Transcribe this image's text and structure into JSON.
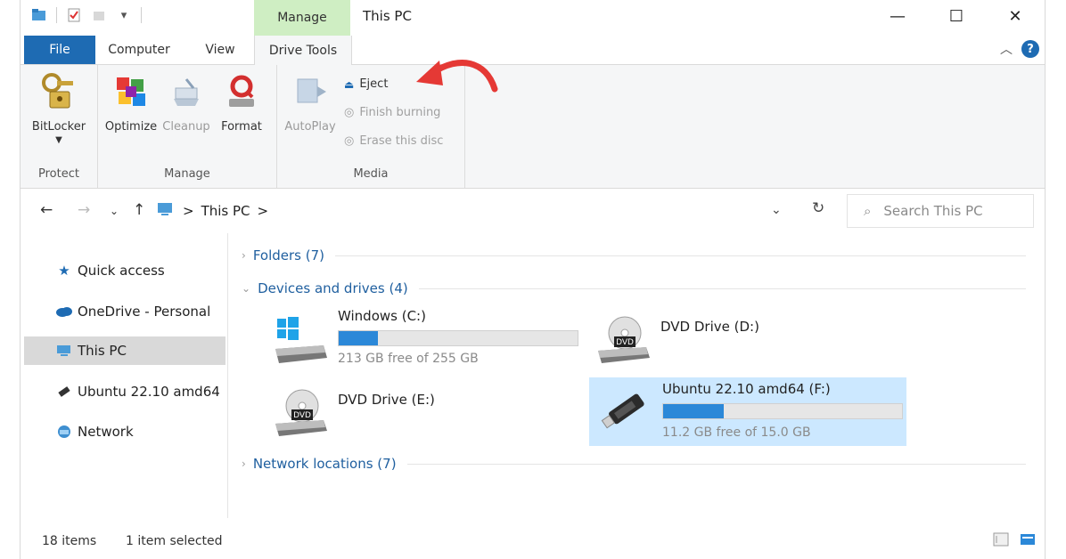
{
  "quick_access_toolbar": {
    "items": [
      "folder-icon",
      "properties-icon",
      "new-folder-icon",
      "dropdown-icon"
    ]
  },
  "context_tab_label": "Manage",
  "window_title": "This PC",
  "window_controls": {
    "minimize": "—",
    "maximize": "☐",
    "close": "✕"
  },
  "tabs": {
    "file": "File",
    "computer": "Computer",
    "view": "View",
    "drive_tools": "Drive Tools"
  },
  "ribbon": {
    "protect": {
      "label": "Protect",
      "bitlocker": "BitLocker"
    },
    "manage": {
      "label": "Manage",
      "optimize": "Optimize",
      "cleanup": "Cleanup",
      "format": "Format"
    },
    "media": {
      "label": "Media",
      "autoplay": "AutoPlay",
      "eject": "Eject",
      "finish_burning": "Finish burning",
      "erase_disc": "Erase this disc"
    }
  },
  "address_bar": {
    "path_label": "This PC",
    "separator": ">",
    "search_placeholder": "Search This PC"
  },
  "nav_pane": {
    "items": [
      {
        "label": "Quick access",
        "icon": "star-icon"
      },
      {
        "label": "OneDrive - Personal",
        "icon": "cloud-icon"
      },
      {
        "label": "This PC",
        "icon": "computer-icon",
        "selected": true
      },
      {
        "label": "Ubuntu 22.10 amd64",
        "icon": "usb-drive-icon"
      },
      {
        "label": "Network",
        "icon": "network-icon"
      }
    ]
  },
  "content": {
    "folders_header": "Folders (7)",
    "devices_header": "Devices and drives (4)",
    "network_header": "Network locations (7)",
    "drives": [
      {
        "name": "Windows (C:)",
        "free_text": "213 GB free of 255 GB",
        "used_fraction": 0.165,
        "icon": "windows-drive-icon"
      },
      {
        "name": "DVD Drive (D:)",
        "icon": "dvd-drive-icon"
      },
      {
        "name": "DVD Drive (E:)",
        "icon": "dvd-drive-icon"
      },
      {
        "name": "Ubuntu 22.10 amd64 (F:)",
        "free_text": "11.2 GB free of 15.0 GB",
        "used_fraction": 0.253,
        "icon": "usb-drive-icon",
        "selected": true
      }
    ]
  },
  "status_bar": {
    "item_count": "18 items",
    "selection": "1 item selected"
  },
  "colors": {
    "accent": "#1e6bb3",
    "context_tab": "#cfeec3",
    "selection": "#cce8ff",
    "progress": "#2b88d8",
    "annotation_arrow": "#e53935"
  }
}
